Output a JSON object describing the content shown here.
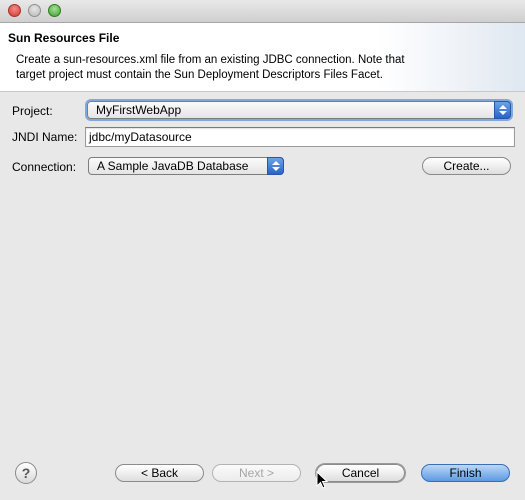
{
  "banner": {
    "title": "Sun Resources File",
    "description_line1": "Create a sun-resources.xml file from an existing JDBC connection. Note that",
    "description_line2": "target project must contain the Sun Deployment Descriptors Files Facet."
  },
  "form": {
    "project_label": "Project:",
    "project_value": "MyFirstWebApp",
    "jndi_label": "JNDI Name:",
    "jndi_value": "jdbc/myDatasource",
    "connection_label": "Connection:",
    "connection_value": "A Sample JavaDB Database",
    "create_button": "Create..."
  },
  "footer": {
    "help_glyph": "?",
    "back_button": "< Back",
    "next_button": "Next >",
    "cancel_button": "Cancel",
    "finish_button": "Finish"
  },
  "icons": {
    "help": "help-icon",
    "cursor": "mouse-pointer-icon"
  },
  "colors": {
    "accent": "#5c9ae3",
    "close": "#d6342b",
    "maximize": "#3f9d2d"
  }
}
